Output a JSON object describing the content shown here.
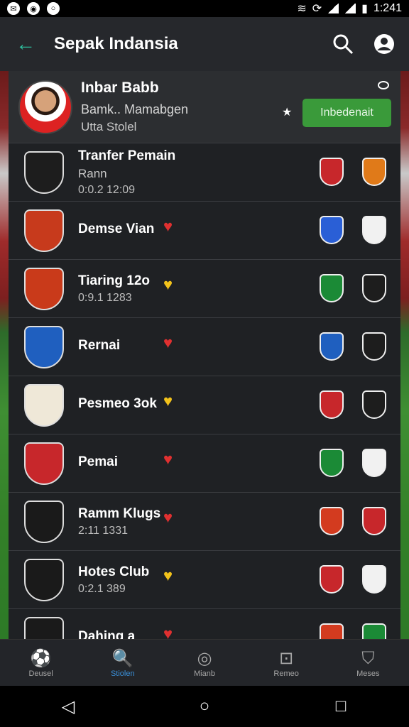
{
  "status": {
    "time": "1:241"
  },
  "appbar": {
    "title": "Sepak Indansia",
    "back_icon": "arrow-left-icon",
    "search_icon": "search-icon",
    "profile_icon": "account-circle-icon"
  },
  "featured": {
    "name": "Inbar Babb",
    "subtitle": "Bamk.. Mamabgen",
    "subtitle2": "Utta Stolel",
    "follow_label": "Inbedenait"
  },
  "items": [
    {
      "title": "Tranfer Pemain",
      "subtitle": "Rann",
      "meta": "0:0.2 12:09",
      "heart": "",
      "crest": "#1d1d1d",
      "b1": "#c7272b",
      "b2": "#e07a19"
    },
    {
      "title": "Demse Vian",
      "subtitle": "",
      "meta": "",
      "heart": "♥",
      "heart_color": "#e03030",
      "crest": "#c73a1c",
      "b1": "#2a5fd6",
      "b2": "#f1f1f1"
    },
    {
      "title": "Tiaring 12o",
      "subtitle": "",
      "meta": "0:9.1 1283",
      "heart": "♥",
      "heart_color": "#f2c21b",
      "crest": "#c93a1a",
      "b1": "#1b8a36",
      "b2": "#1d1d1d"
    },
    {
      "title": "Rernai",
      "subtitle": "",
      "meta": "",
      "heart": "♥",
      "heart_color": "#e03030",
      "crest": "#1f5fbf",
      "b1": "#1f5fbf",
      "b2": "#1d1d1d"
    },
    {
      "title": "Pesmeo 3ok",
      "subtitle": "",
      "meta": "",
      "heart": "♥",
      "heart_color": "#f2c21b",
      "crest": "#efe8d8",
      "b1": "#c7272b",
      "b2": "#1d1d1d"
    },
    {
      "title": "Pemai",
      "subtitle": "",
      "meta": "",
      "heart": "♥",
      "heart_color": "#e03030",
      "crest": "#c7272b",
      "b1": "#1b8a36",
      "b2": "#f1f1f1"
    },
    {
      "title": "Ramm Klugs",
      "subtitle": "",
      "meta": "2:11 1331",
      "heart": "♥",
      "heart_color": "#e03030",
      "crest": "#1a1a1a",
      "b1": "#d33b1f",
      "b2": "#c7272b"
    },
    {
      "title": "Hotes Club",
      "subtitle": "",
      "meta": "0:2.1 389",
      "heart": "♥",
      "heart_color": "#f2c21b",
      "crest": "#1a1a1a",
      "b1": "#c7272b",
      "b2": "#f1f1f1"
    },
    {
      "title": "Dahing a",
      "subtitle": "",
      "meta": "",
      "heart": "♥",
      "heart_color": "#e03030",
      "crest": "#1a1a1a",
      "b1": "#d33b1f",
      "b2": "#1b8a36"
    }
  ],
  "bottom_nav": [
    {
      "label": "Deusel",
      "icon": "soccer-icon"
    },
    {
      "label": "Stiolen",
      "icon": "search-icon"
    },
    {
      "label": "Mianb",
      "icon": "ball-icon"
    },
    {
      "label": "Remeo",
      "icon": "stadium-icon"
    },
    {
      "label": "Meses",
      "icon": "trophy-icon"
    }
  ],
  "colors": {
    "accent": "#2fbf9f",
    "follow_green": "#3a9a3a",
    "nav_active": "#3a8fd8"
  }
}
